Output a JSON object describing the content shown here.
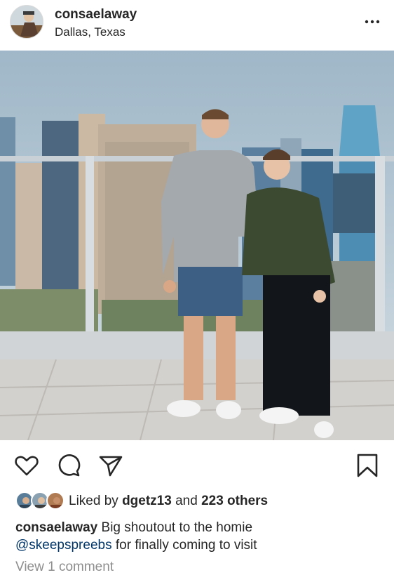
{
  "post": {
    "username": "consaelaway",
    "location": "Dallas, Texas"
  },
  "icons": {
    "more": "more-options-icon",
    "like": "heart-icon",
    "comment": "comment-bubble-icon",
    "share": "paper-plane-icon",
    "save": "bookmark-icon"
  },
  "likes": {
    "prefix": "Liked by",
    "user": "dgetz13",
    "and": "and",
    "others": "223 others"
  },
  "caption": {
    "username": "consaelaway",
    "text": "Big shoutout to the homie",
    "mention": "@skeepspreebs",
    "text2": "for finally coming to visit"
  },
  "comments": {
    "label": "View 1 comment"
  },
  "colors": {
    "text": "#262626",
    "muted": "#8e8e8e",
    "mention": "#003569",
    "divider": "#efefef"
  }
}
